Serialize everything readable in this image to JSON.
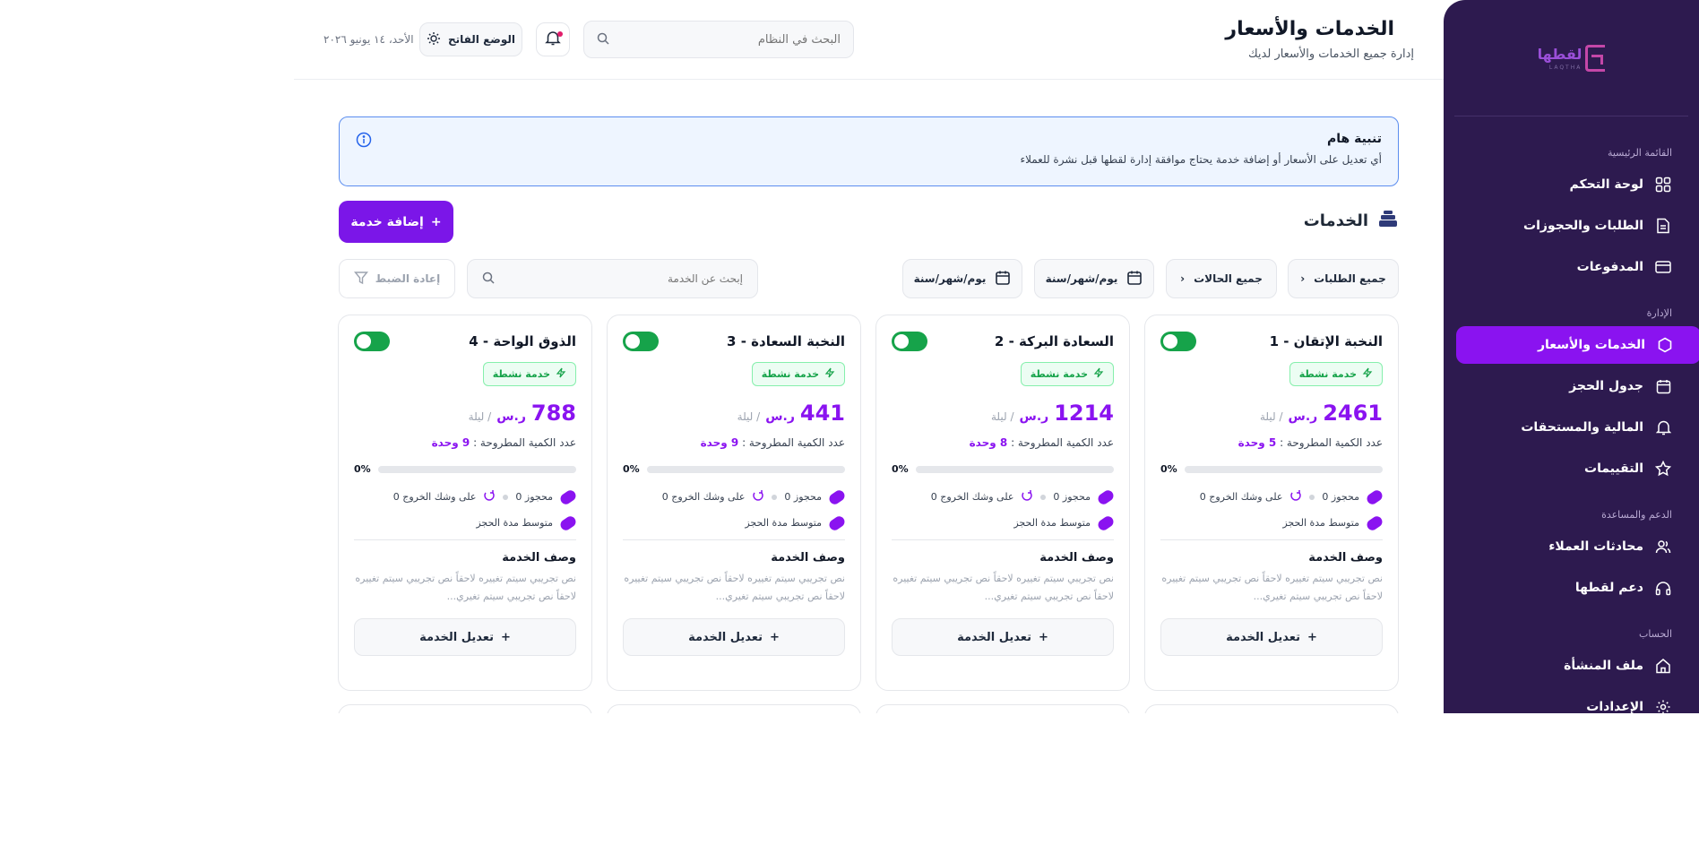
{
  "sidebar": {
    "logo_text": "لقطها",
    "logo_sub": "LAQTHA",
    "sections": {
      "main": "القائمة الرئيسية",
      "admin": "الإدارة",
      "support": "الدعم والمساعدة",
      "account": "الحساب"
    },
    "items": {
      "dashboard": "لوحة التحكم",
      "orders": "الطلبات والحجوزات",
      "payments": "المدفوعات",
      "services": "الخدمات والأسعار",
      "schedule": "جدول الحجز",
      "finance": "المالية والمستحقات",
      "reviews": "التقييمات",
      "chats": "محادثات العملاء",
      "support": "دعم لقطها",
      "profile": "ملف المنشأة",
      "settings": "الإعدادات"
    }
  },
  "header": {
    "title": "الخدمات والأسعار",
    "subtitle": "إدارة جميع الخدمات والأسعار لديك",
    "search_placeholder": "البحث في النظام",
    "theme_label": "الوضع الفاتح",
    "date": "الأحد، ١٤ يونيو ٢٠٢٦"
  },
  "alert": {
    "title": "تنبية هام",
    "text": "أي تعديل على الأسعار أو إضافة خدمة يحتاج موافقة إدارة لقطها قبل نشرة للعملاء"
  },
  "section": {
    "title": "الخدمات",
    "add_label": "إضافة خدمة"
  },
  "filters": {
    "all_orders": "جميع الطلبات",
    "all_statuses": "جميع الحالات",
    "date_from": "يوم/شهر/سنة",
    "date_to": "يوم/شهر/سنة",
    "search_placeholder": "إبحث عن الخدمة",
    "reset_label": "إعادة الضبط"
  },
  "card_labels": {
    "status": "خدمة نشطة",
    "currency": "ر.س",
    "per": "/ ليلة",
    "qty_label": "عدد الكمية المطروحة :",
    "booked": "محجوز 0",
    "checkout_soon": "على وشك الخروج 0",
    "avg_booking": "متوسط مدة الحجز",
    "desc_title": "وصف الخدمة",
    "desc_text": "نص تجريبي سيتم تغييره لاحقاً نص تجريبي سيتم تغييره لاحقاً نص تجريبي سيتم تغيري...",
    "edit_label": "تعديل الخدمة"
  },
  "services": [
    {
      "name": "النخبة الإتقان - 1",
      "price": "2461",
      "qty": "5 وحدة",
      "progress_pct": "0%",
      "progress_fraction": 0
    },
    {
      "name": "السعادة البركة - 2",
      "price": "1214",
      "qty": "8 وحدة",
      "progress_pct": "0%",
      "progress_fraction": 0
    },
    {
      "name": "النخبة السعادة - 3",
      "price": "441",
      "qty": "9 وحدة",
      "progress_pct": "0%",
      "progress_fraction": 0
    },
    {
      "name": "الذوق الواحة - 4",
      "price": "788",
      "qty": "9 وحدة",
      "progress_pct": "0%",
      "progress_fraction": 0
    }
  ],
  "colors": {
    "sidebar_bg": "#2d1a4f",
    "accent": "#8a13f0",
    "success": "#16a34a",
    "alert_border": "#5b8def"
  }
}
